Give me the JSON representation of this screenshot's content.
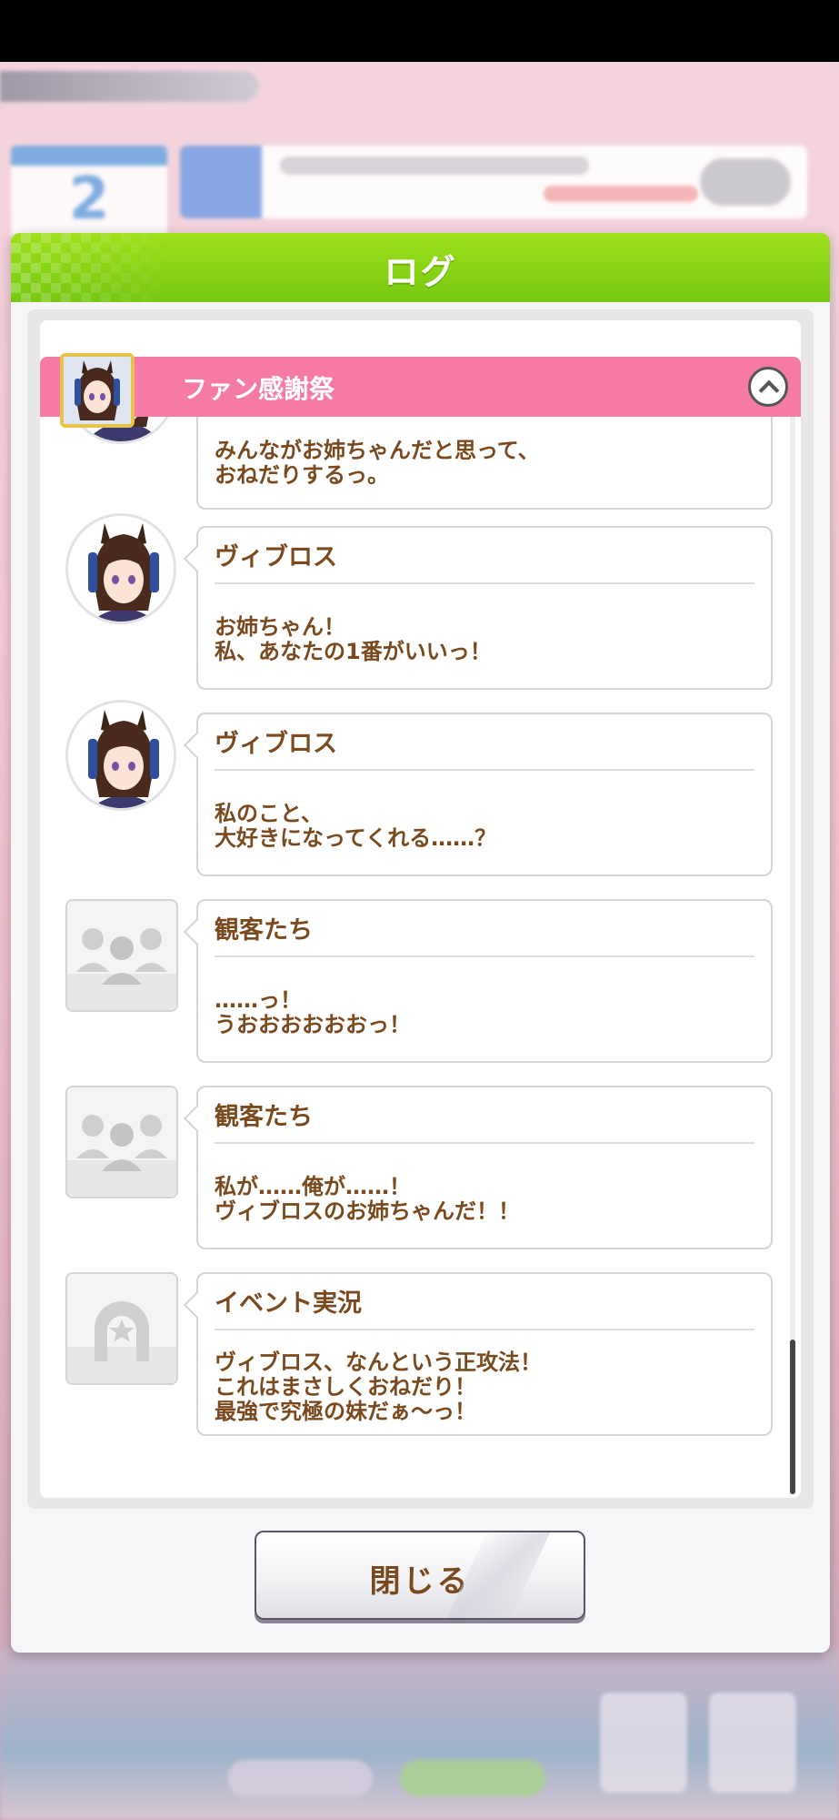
{
  "dialog": {
    "title": "ログ",
    "close_label": "閉じる"
  },
  "section": {
    "title": "ファン感謝祭"
  },
  "entries": [
    {
      "speaker": "",
      "lines": [
        "みんながお姉ちゃんだと思って、",
        "おねだりするっ。"
      ],
      "avatar": "character"
    },
    {
      "speaker": "ヴィブロス",
      "lines": [
        "お姉ちゃん！",
        "私、あなたの1番がいいっ！"
      ],
      "avatar": "character"
    },
    {
      "speaker": "ヴィブロス",
      "lines": [
        "私のこと、",
        "大好きになってくれる……？"
      ],
      "avatar": "character"
    },
    {
      "speaker": "観客たち",
      "lines": [
        "……っ！",
        "うおおおおおおっ！"
      ],
      "avatar": "crowd"
    },
    {
      "speaker": "観客たち",
      "lines": [
        "私が……俺が……！",
        "ヴィブロスのお姉ちゃんだ！！"
      ],
      "avatar": "crowd"
    },
    {
      "speaker": "イベント実況",
      "lines": [
        "ヴィブロス、なんという正攻法！",
        "これはまさしくおねだり！",
        "最強で究極の妹だぁ～っ！"
      ],
      "avatar": "horseshoe"
    }
  ],
  "background": {
    "day_number": "2"
  },
  "colors": {
    "header_green": "#8fd716",
    "section_pink": "#f57ba6",
    "text_brown": "#7a4a1e"
  }
}
